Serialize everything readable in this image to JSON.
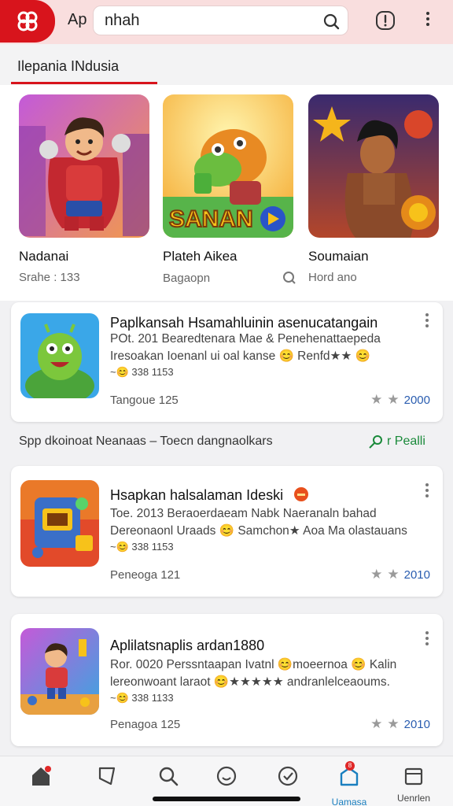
{
  "header": {
    "app_abbr": "Ap",
    "search_value": "nhah",
    "logo_glyph": "ꕤ",
    "brand_color": "#d8141c"
  },
  "section": {
    "title": "Ilepania INdusia"
  },
  "featured": [
    {
      "title": "Nadanai",
      "subtitle": "Srahe : 133",
      "art": "hero-character"
    },
    {
      "title": "Plateh Aikea",
      "subtitle": "Bagaopn",
      "art": "dragon-game",
      "banner": "SANAN"
    },
    {
      "title": "Soumaian",
      "subtitle": "Hord ano",
      "art": "warrior-character"
    }
  ],
  "apps": [
    {
      "title": "Paplkansah Hsamahluinin asenucatangain",
      "desc1": "POt. 201  Bearedtenara Mae  &  Penehenattaepeda",
      "desc2": "Iresoakan Ioenanl ui oal kanse  😊 Renfd★★  😊",
      "desc3": "~😊 338 1153",
      "meta": "Tangoue  125",
      "rating": "2000"
    },
    {
      "title": "Hsapkan halsalaman Ideski",
      "desc1": "Toe. 2013 Beraoerdaeam Nabk Naeranaln bahad",
      "desc2": "Dereonaonl Uraads  😊 Samchon★  Aoa Ma olastauans",
      "desc3": "~😊 338 1153",
      "meta": "Peneoga  121",
      "rating": "2010"
    },
    {
      "title": "Aplilatsnaplis ardan1880",
      "desc1": "Ror. 0020 Perssntaapan Ivatnl 😊moeernoa  😊 Kalin",
      "desc2": "lereonwoant laraot 😊★★★★★  andranlelceaoums.",
      "desc3": "~😊 338 1133",
      "meta": "Penagoa  125",
      "rating": "2010"
    }
  ],
  "subheader": {
    "text": "Spp dkoinoat Neanaas – Toecn dangnaolkars",
    "link": "r Pealli"
  },
  "nav": [
    {
      "label": "",
      "icon": "home-icon"
    },
    {
      "label": "",
      "icon": "bookmark-icon"
    },
    {
      "label": "",
      "icon": "search-icon"
    },
    {
      "label": "",
      "icon": "smile-icon"
    },
    {
      "label": "",
      "icon": "clock-icon"
    },
    {
      "label": "Uamasa",
      "icon": "updates-icon",
      "active": true
    },
    {
      "label": "Uenrlen",
      "icon": "library-icon"
    }
  ],
  "nav_badge": "8"
}
